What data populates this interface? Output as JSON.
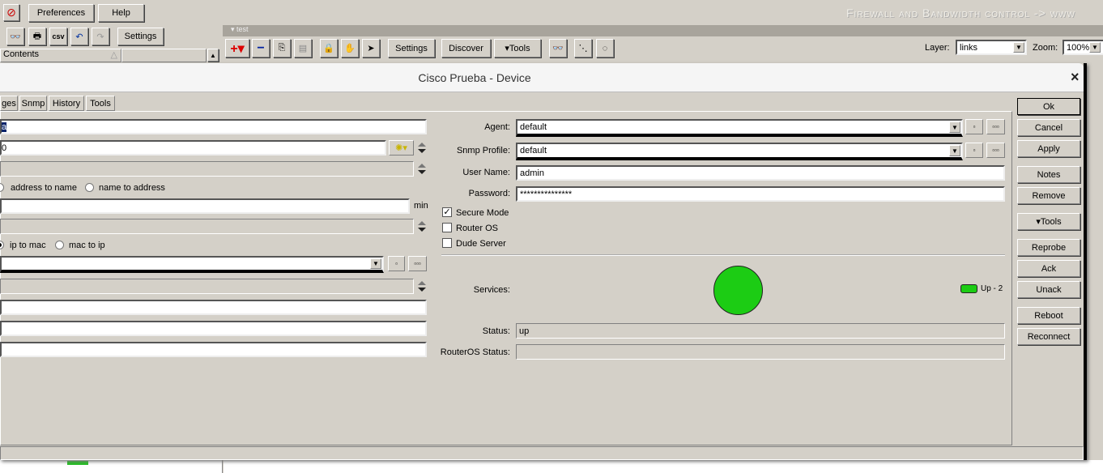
{
  "top": {
    "preferences": "Preferences",
    "help": "Help",
    "settings": "Settings",
    "csv": "csv",
    "banner": "Firewall and Bandwidth control -> www"
  },
  "left_panel": {
    "column": "Contents"
  },
  "map": {
    "title": "test",
    "settings": "Settings",
    "discover": "Discover",
    "tools": "Tools",
    "layer_label": "Layer:",
    "layer_value": "links",
    "zoom_label": "Zoom:",
    "zoom_value": "100%"
  },
  "dialog": {
    "title": "Cisco Prueba - Device",
    "close": "×",
    "tabs": [
      "ges",
      "Snmp",
      "History",
      "Tools"
    ],
    "left": {
      "name_value": "a",
      "address_value": "0",
      "radio_a1": "address to name",
      "radio_a2": "name to address",
      "min_label": "min",
      "radio_b1": "ip to mac",
      "radio_b2": "mac to ip"
    },
    "right": {
      "agent_label": "Agent:",
      "agent_value": "default",
      "snmp_label": "Snmp Profile:",
      "snmp_value": "default",
      "user_label": "User Name:",
      "user_value": "admin",
      "password_label": "Password:",
      "password_value": "***************",
      "secure_mode": "Secure Mode",
      "router_os": "Router OS",
      "dude_server": "Dude Server",
      "services_label": "Services:",
      "legend": "Up - 2",
      "status_label": "Status:",
      "status_value": "up",
      "routeros_label": "RouterOS Status:",
      "routeros_value": ""
    },
    "checks": {
      "secure_mode": true,
      "router_os": false,
      "dude_server": false
    },
    "buttons": [
      "Ok",
      "Cancel",
      "Apply",
      "Notes",
      "Remove",
      "Tools",
      "Reprobe",
      "Ack",
      "Unack",
      "Reboot",
      "Reconnect"
    ],
    "services_color": "#1ccc14"
  }
}
